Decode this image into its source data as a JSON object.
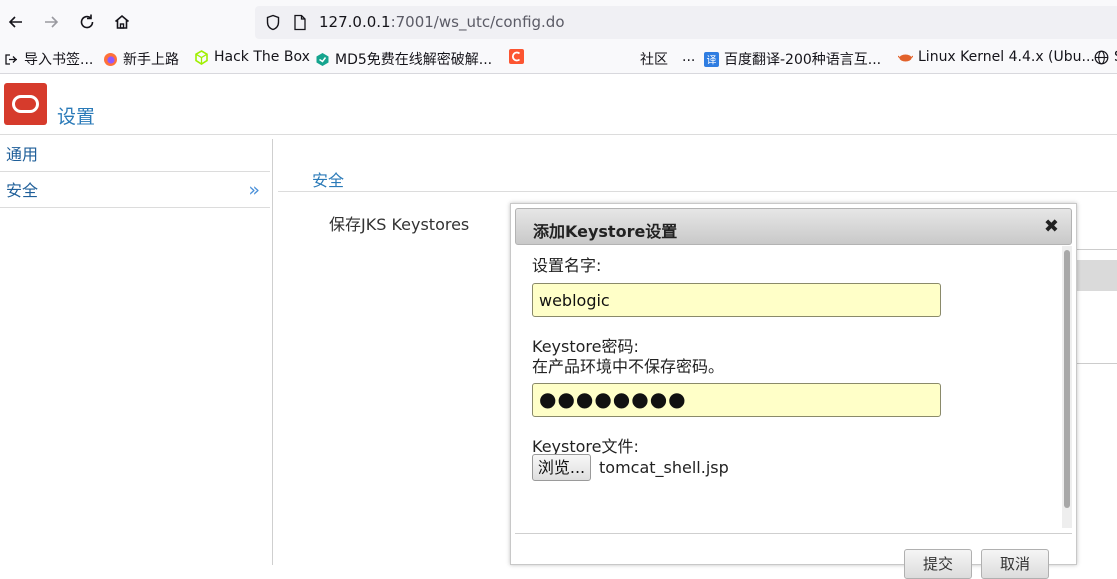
{
  "browser": {
    "url_host": "127.0.0.1",
    "url_rest": ":7001/ws_utc/config.do",
    "bookmarks": [
      {
        "label": "导入书签..."
      },
      {
        "label": "新手上路"
      },
      {
        "label": "Hack The Box"
      },
      {
        "label": "MD5免费在线解密破解..."
      },
      {
        "label": ""
      },
      {
        "label": "社区"
      },
      {
        "label": "..."
      },
      {
        "label": "百度翻译-200种语言互..."
      },
      {
        "label": "Linux Kernel 4.4.x (Ubu..."
      },
      {
        "label": "S"
      }
    ]
  },
  "app": {
    "title": "设置"
  },
  "sidebar": {
    "items": [
      {
        "label": "通用"
      },
      {
        "label": "安全",
        "arrow": "»"
      }
    ]
  },
  "main": {
    "section_title": "安全",
    "jks_label": "保存JKS Keystores"
  },
  "dialog": {
    "title": "添加Keystore设置",
    "close": "✖",
    "name_label": "设置名字:",
    "name_value": "weblogic",
    "password_label": "Keystore密码:",
    "password_hint": "在产品环境中不保存密码。",
    "password_mask": "●●●●●●●●",
    "file_label": "Keystore文件:",
    "browse_label": "浏览...",
    "file_name": "tomcat_shell.jsp",
    "submit_label": "提交",
    "cancel_label": "取消"
  }
}
